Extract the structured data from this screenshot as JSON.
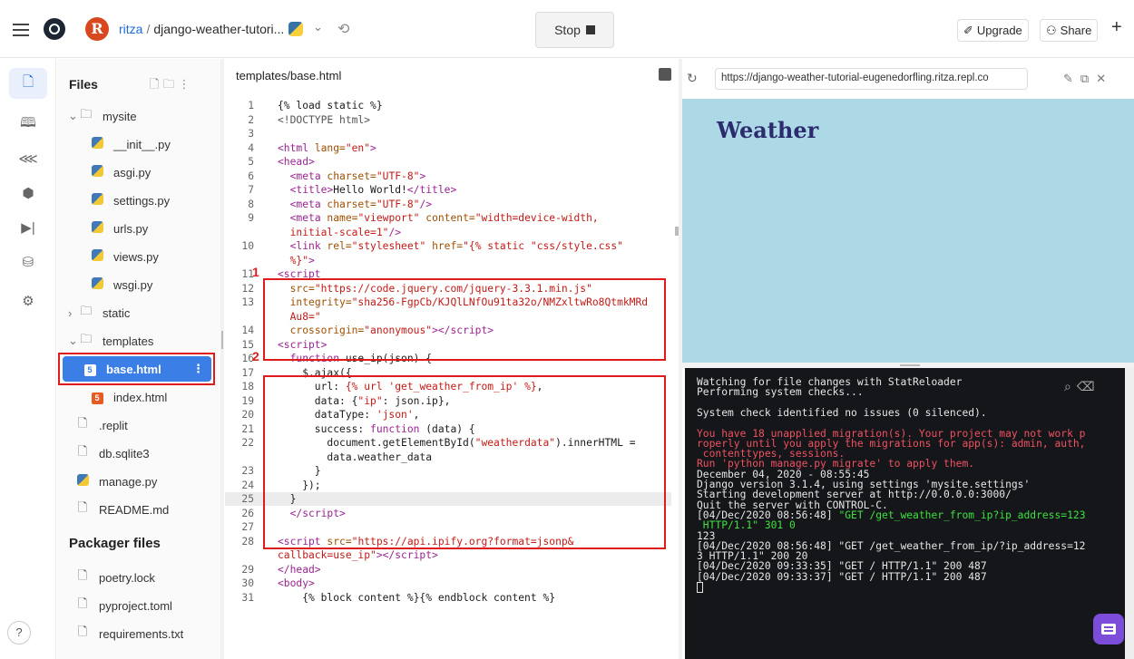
{
  "topbar": {
    "username": "ritza",
    "separator": "/",
    "project": "django-weather-tutori...",
    "stop_label": "Stop",
    "upgrade_label": "Upgrade",
    "share_label": "Share",
    "avatar_letter": "R"
  },
  "files": {
    "title": "Files",
    "packager_title": "Packager files",
    "tree": [
      {
        "label": "mysite",
        "icon": "folder-icon",
        "prefix": "⌄",
        "indent": 0
      },
      {
        "label": "__init__.py",
        "icon": "python-file-icon",
        "indent": 2
      },
      {
        "label": "asgi.py",
        "icon": "python-file-icon",
        "indent": 2
      },
      {
        "label": "settings.py",
        "icon": "python-file-icon",
        "indent": 2
      },
      {
        "label": "urls.py",
        "icon": "python-file-icon",
        "indent": 2
      },
      {
        "label": "views.py",
        "icon": "python-file-icon",
        "indent": 2
      },
      {
        "label": "wsgi.py",
        "icon": "python-file-icon",
        "indent": 2
      },
      {
        "label": "static",
        "icon": "folder-icon",
        "prefix": "›",
        "indent": 0
      },
      {
        "label": "templates",
        "icon": "folder-icon",
        "prefix": "⌄",
        "indent": 0
      },
      {
        "label": "base.html",
        "icon": "html-file-icon",
        "indent": 2,
        "selected": true
      },
      {
        "label": "index.html",
        "icon": "html-file-icon",
        "indent": 2
      },
      {
        "label": ".replit",
        "icon": "file-icon",
        "indent": 1
      },
      {
        "label": "db.sqlite3",
        "icon": "file-icon",
        "indent": 1
      },
      {
        "label": "manage.py",
        "icon": "python-file-icon",
        "indent": 1
      },
      {
        "label": "README.md",
        "icon": "file-icon",
        "indent": 1
      }
    ],
    "packager": [
      {
        "label": "poetry.lock",
        "icon": "file-icon"
      },
      {
        "label": "pyproject.toml",
        "icon": "file-icon"
      },
      {
        "label": "requirements.txt",
        "icon": "file-icon"
      }
    ],
    "help_label": "?"
  },
  "editor": {
    "tab_label": "templates/base.html",
    "annotation_1": "1",
    "annotation_2": "2",
    "lines": [
      {
        "n": "1",
        "html": "<span class=\"tx\">{% load static %}</span>"
      },
      {
        "n": "2",
        "html": "<span class=\"cm\">&lt;!DOCTYPE html&gt;</span>"
      },
      {
        "n": "3",
        "html": ""
      },
      {
        "n": "4",
        "html": "<span class=\"tg\">&lt;html </span><span class=\"at\">lang=</span><span class=\"st\">\"en\"</span><span class=\"tg\">&gt;</span>"
      },
      {
        "n": "5",
        "html": "<span class=\"tg\">&lt;head&gt;</span>"
      },
      {
        "n": "6",
        "html": "  <span class=\"tg\">&lt;meta </span><span class=\"at\">charset=</span><span class=\"st\">\"UTF-8\"</span><span class=\"tg\">&gt;</span>"
      },
      {
        "n": "7",
        "html": "  <span class=\"tg\">&lt;title&gt;</span>Hello World!<span class=\"tg\">&lt;/title&gt;</span>"
      },
      {
        "n": "8",
        "html": "  <span class=\"tg\">&lt;meta </span><span class=\"at\">charset=</span><span class=\"st\">\"UTF-8\"</span><span class=\"tg\">/&gt;</span>"
      },
      {
        "n": "9",
        "html": "  <span class=\"tg\">&lt;meta </span><span class=\"at\">name=</span><span class=\"st\">\"viewport\"</span> <span class=\"at\">content=</span><span class=\"st\">\"width=device-width,</span>"
      },
      {
        "n": "",
        "html": "  <span class=\"st\">initial-scale=1\"</span><span class=\"tg\">/&gt;</span>"
      },
      {
        "n": "10",
        "html": "  <span class=\"tg\">&lt;link </span><span class=\"at\">rel=</span><span class=\"st\">\"stylesheet\"</span> <span class=\"at\">href=</span><span class=\"st\">\"{% static \"css/style.css\"</span>"
      },
      {
        "n": "",
        "html": "  <span class=\"st\">%}\"</span><span class=\"tg\">&gt;</span>"
      },
      {
        "n": "11",
        "html": "<span class=\"tg\">&lt;script</span>"
      },
      {
        "n": "12",
        "html": "  <span class=\"at\">src=</span><span class=\"st\">\"https://code.jquery.com/jquery-3.3.1.min.js\"</span>"
      },
      {
        "n": "13",
        "html": "  <span class=\"at\">integrity=</span><span class=\"st\">\"sha256-FgpCb/KJQlLNfOu91ta32o/NMZxltwRo8QtmkMRd</span>"
      },
      {
        "n": "",
        "html": "  <span class=\"st\">Au8=\"</span>"
      },
      {
        "n": "14",
        "html": "  <span class=\"at\">crossorigin=</span><span class=\"st\">\"anonymous\"</span><span class=\"tg\">&gt;&lt;/script&gt;</span>"
      },
      {
        "n": "15",
        "html": "<span class=\"tg\">&lt;script&gt;</span>"
      },
      {
        "n": "16",
        "html": "  <span class=\"kw\">function</span> use_ip(json) {"
      },
      {
        "n": "17",
        "html": "    $.ajax({"
      },
      {
        "n": "18",
        "html": "      url: <span class=\"st\">{% url 'get_weather_from_ip' %}</span>,"
      },
      {
        "n": "19",
        "html": "      data: {<span class=\"st\">\"ip\"</span>: json.ip},"
      },
      {
        "n": "20",
        "html": "      dataType: <span class=\"st\">'json'</span>,"
      },
      {
        "n": "21",
        "html": "      success: <span class=\"kw\">function</span> (data) {"
      },
      {
        "n": "22",
        "html": "        document.getElementById(<span class=\"st\">\"weatherdata\"</span>).innerHTML ="
      },
      {
        "n": "",
        "html": "        data.weather_data"
      },
      {
        "n": "23",
        "html": "      }"
      },
      {
        "n": "24",
        "html": "    });"
      },
      {
        "n": "25",
        "html": "  }"
      },
      {
        "n": "26",
        "html": "  <span class=\"tg\">&lt;/script&gt;</span>"
      },
      {
        "n": "27",
        "html": ""
      },
      {
        "n": "28",
        "html": "<span class=\"tg\">&lt;script </span><span class=\"at\">src=</span><span class=\"st\">\"https://api.ipify.org?format=jsonp&amp;</span>"
      },
      {
        "n": "",
        "html": "<span class=\"st\">callback=use_ip\"</span><span class=\"tg\">&gt;&lt;/script&gt;</span>"
      },
      {
        "n": "29",
        "html": "<span class=\"tg\">&lt;/head&gt;</span>"
      },
      {
        "n": "30",
        "html": "<span class=\"tg\">&lt;body&gt;</span>"
      },
      {
        "n": "31",
        "html": "    {% block content %}{% endblock content %}"
      }
    ]
  },
  "webview": {
    "url": "https://django-weather-tutorial-eugenedorfling.ritza.repl.co",
    "page_title": "Weather"
  },
  "console": {
    "lines": [
      {
        "t": "Watching for file changes with StatReloader",
        "c": ""
      },
      {
        "t": "Performing system checks...",
        "c": ""
      },
      {
        "t": "",
        "c": ""
      },
      {
        "t": "System check identified no issues (0 silenced).",
        "c": ""
      },
      {
        "t": "",
        "c": ""
      },
      {
        "t": "You have 18 unapplied migration(s). Your project may not work p",
        "c": "cons-red"
      },
      {
        "t": "roperly until you apply the migrations for app(s): admin, auth,",
        "c": "cons-red"
      },
      {
        "t": " contenttypes, sessions.",
        "c": "cons-red"
      },
      {
        "t": "Run 'python manage.py migrate' to apply them.",
        "c": "cons-red"
      },
      {
        "t": "December 04, 2020 - 08:55:45",
        "c": ""
      },
      {
        "t": "Django version 3.1.4, using settings 'mysite.settings'",
        "c": ""
      },
      {
        "t": "Starting development server at http://0.0.0.0:3000/",
        "c": ""
      },
      {
        "t": "Quit the server with CONTROL-C.",
        "c": ""
      },
      {
        "t": "[04/Dec/2020 08:56:48] \"GET /get_weather_from_ip?ip_address=123",
        "c": "",
        "green_from": 23
      },
      {
        "t": " HTTP/1.1\" 301 0",
        "c": "cons-green"
      },
      {
        "t": "123",
        "c": ""
      },
      {
        "t": "[04/Dec/2020 08:56:48] \"GET /get_weather_from_ip/?ip_address=12",
        "c": ""
      },
      {
        "t": "3 HTTP/1.1\" 200 20",
        "c": ""
      },
      {
        "t": "[04/Dec/2020 09:33:35] \"GET / HTTP/1.1\" 200 487",
        "c": ""
      },
      {
        "t": "[04/Dec/2020 09:33:37] \"GET / HTTP/1.1\" 200 487",
        "c": ""
      }
    ]
  }
}
